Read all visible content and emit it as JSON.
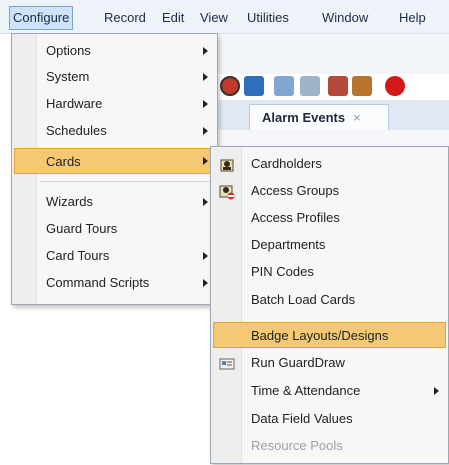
{
  "menubar": {
    "items": [
      "Configure",
      "Record",
      "Edit",
      "View",
      "Utilities",
      "Window",
      "Help"
    ]
  },
  "background": {
    "tab_label": "Alarm Events",
    "tab_close": "×"
  },
  "configure_menu": {
    "items": [
      "Options",
      "System",
      "Hardware",
      "Schedules",
      "Cards",
      "Wizards",
      "Guard Tours",
      "Card Tours",
      "Command Scripts"
    ],
    "selected": "Cards"
  },
  "cards_menu": {
    "items": [
      "Cardholders",
      "Access Groups",
      "Access Profiles",
      "Departments",
      "PIN Codes",
      "Batch Load Cards",
      "Badge Layouts/Designs",
      "Run GuardDraw",
      "Time & Attendance",
      "Data Field Values",
      "Resource Pools"
    ],
    "highlighted": "Badge Layouts/Designs",
    "disabled": "Resource Pools"
  },
  "colors": {
    "highlight": "#f5c873",
    "highlight_border": "#e3a438",
    "menubar_active": "#cfe3f8"
  }
}
